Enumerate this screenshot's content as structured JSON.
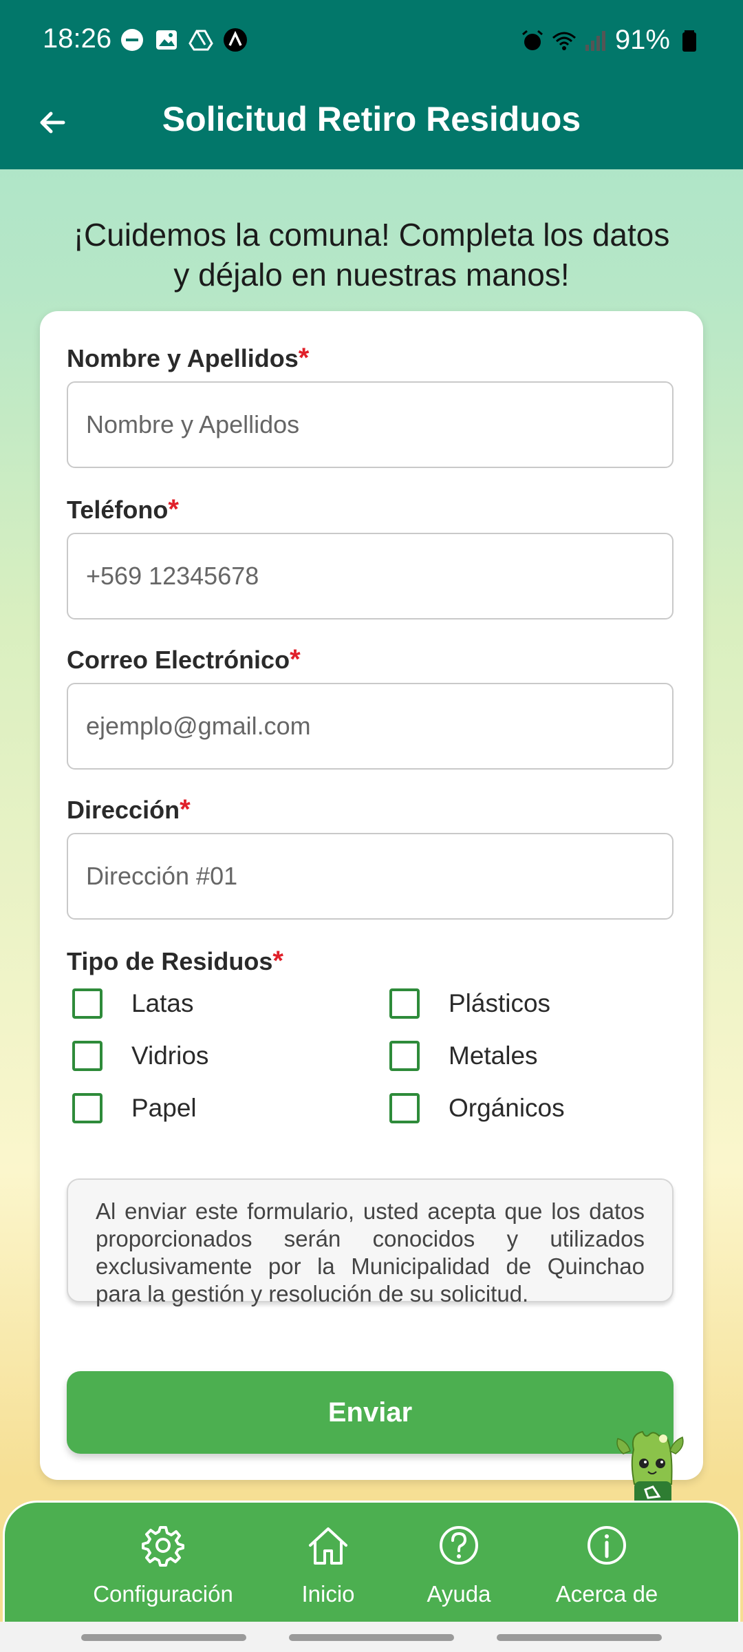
{
  "status_bar": {
    "time": "18:26",
    "battery": "91%",
    "icons_left": [
      "minus-circle-icon",
      "image-icon",
      "drive-icon",
      "app-a-icon"
    ],
    "icons_right": [
      "alarm-icon",
      "wifi-icon",
      "signal-icon",
      "battery-icon"
    ]
  },
  "app_bar": {
    "title": "Solicitud Retiro Residuos",
    "back_icon": "arrow-left-icon"
  },
  "intro": {
    "line1": "¡Cuidemos la comuna! Completa los datos",
    "line2": "y déjalo en nuestras manos!"
  },
  "form": {
    "required_mark": "*",
    "name": {
      "label": "Nombre y Apellidos",
      "placeholder": "Nombre y Apellidos",
      "value": ""
    },
    "phone": {
      "label": "Teléfono",
      "placeholder": "+569 12345678",
      "value": ""
    },
    "email": {
      "label": "Correo Electrónico",
      "placeholder": "ejemplo@gmail.com",
      "value": ""
    },
    "address": {
      "label": "Dirección",
      "placeholder": "Dirección #01",
      "value": ""
    },
    "waste": {
      "label": "Tipo de Residuos",
      "options": [
        {
          "label": "Latas",
          "checked": false
        },
        {
          "label": "Plásticos",
          "checked": false
        },
        {
          "label": "Vidrios",
          "checked": false
        },
        {
          "label": "Metales",
          "checked": false
        },
        {
          "label": "Papel",
          "checked": false
        },
        {
          "label": "Orgánicos",
          "checked": false
        }
      ]
    },
    "notice": "Al enviar este formulario, usted acepta que los datos proporcionados serán conocidos y utilizados exclusivamente por la Municipalidad de Quinchao para la gestión y resolución de su solicitud.",
    "submit_label": "Enviar"
  },
  "bottom_nav": {
    "items": [
      {
        "label": "Configuración",
        "icon": "gear-icon"
      },
      {
        "label": "Inicio",
        "icon": "home-icon"
      },
      {
        "label": "Ayuda",
        "icon": "help-icon"
      },
      {
        "label": "Acerca de",
        "icon": "info-icon"
      }
    ]
  },
  "colors": {
    "primary": "#02776a",
    "accent": "#4caf50",
    "checkbox": "#2e8b3a",
    "required": "#e0202a"
  }
}
